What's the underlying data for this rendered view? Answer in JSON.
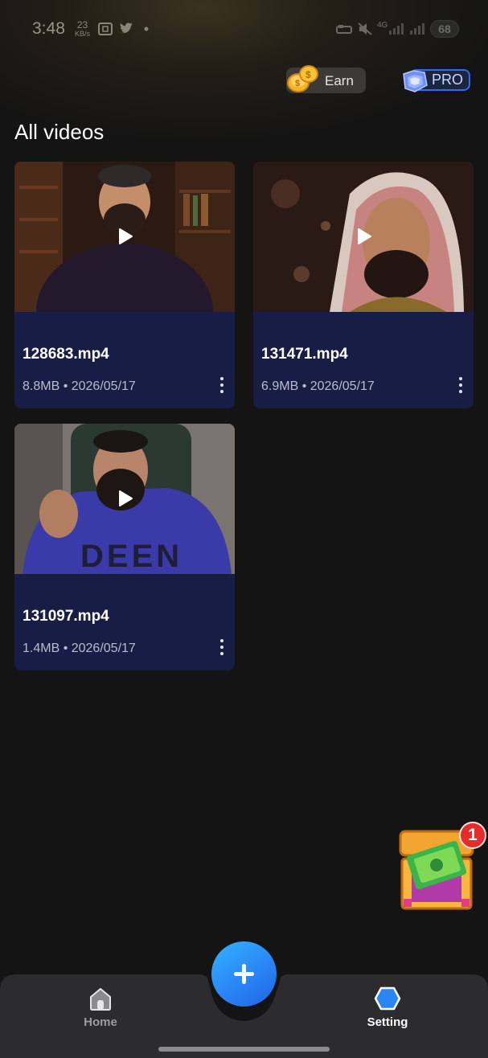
{
  "status_bar": {
    "time": "3:48",
    "net_speed_value": "23",
    "net_speed_unit": "KB/s",
    "battery": "68",
    "network": "4G",
    "icons": [
      "screenshot-icon",
      "twitter-icon",
      "dot-icon",
      "alarm-icon",
      "mute-icon",
      "signal-icon",
      "battery-icon"
    ]
  },
  "header": {
    "earn_label": "Earn",
    "pro_label": "PRO"
  },
  "page_title": "All videos",
  "videos": [
    {
      "name": "128683.mp4",
      "meta": "8.8MB • 2026/05/17"
    },
    {
      "name": "131471.mp4",
      "meta": "6.9MB • 2026/05/17"
    },
    {
      "name": "131097.mp4",
      "meta": "1.4MB • 2026/05/17"
    }
  ],
  "thumbnail_text": {
    "shirt_text": "DEEN"
  },
  "treasure": {
    "badge_count": "1"
  },
  "bottom_nav": {
    "home_label": "Home",
    "setting_label": "Setting"
  },
  "colors": {
    "background": "#141414",
    "card": "#181d45",
    "accent_blue": "#2a86f5",
    "badge_red": "#e62b2b"
  }
}
